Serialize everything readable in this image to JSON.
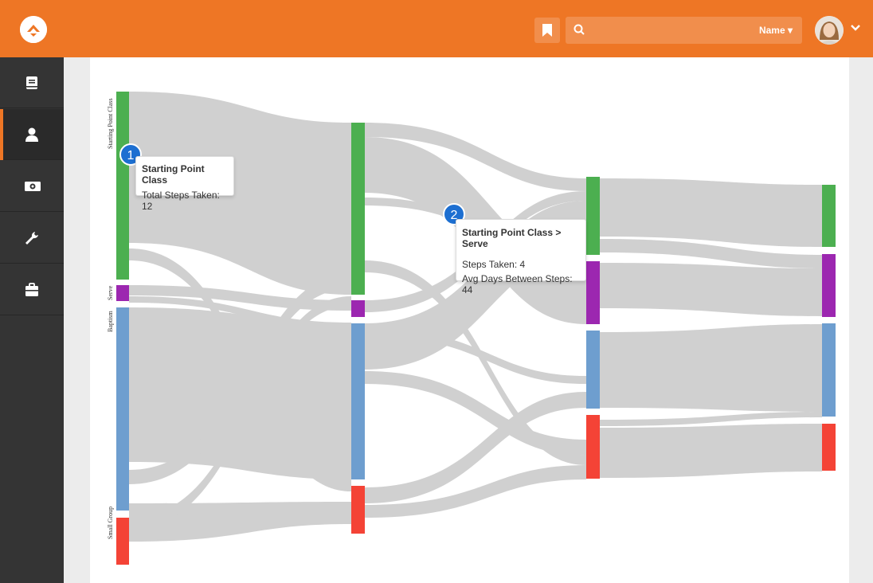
{
  "header": {
    "logo_icon": "rock-logo-icon",
    "bookmark_icon": "bookmark-icon",
    "search": {
      "placeholder": "",
      "scope_label": "Name ▾",
      "icon": "search-icon"
    },
    "user_avatar": "avatar",
    "menu_icon": "chevron-down-icon",
    "brand_color": "#ee7625"
  },
  "sidebar": {
    "items": [
      {
        "name": "book",
        "icon": "book-icon",
        "active": false
      },
      {
        "name": "people",
        "icon": "user-icon",
        "active": true
      },
      {
        "name": "finance",
        "icon": "money-icon",
        "active": false
      },
      {
        "name": "tools",
        "icon": "wrench-icon",
        "active": false
      },
      {
        "name": "admin",
        "icon": "briefcase-icon",
        "active": false
      }
    ]
  },
  "chart_data": {
    "type": "sankey",
    "node_labels": [
      "Starting Point Class",
      "Serve",
      "Baptism",
      "Small Group"
    ],
    "colors": {
      "Starting Point Class": "#4caf50",
      "Serve": "#9c27b0",
      "Baptism": "#6e9ecf",
      "Small Group": "#f44336"
    },
    "columns": 4,
    "tooltips": [
      {
        "callout": "1",
        "title": "Starting Point Class",
        "lines": [
          "Total Steps Taken: 12"
        ]
      },
      {
        "callout": "2",
        "title": "Starting Point Class > Serve",
        "lines": [
          "Steps Taken: 4",
          "Avg Days Between Steps: 44"
        ]
      }
    ]
  }
}
